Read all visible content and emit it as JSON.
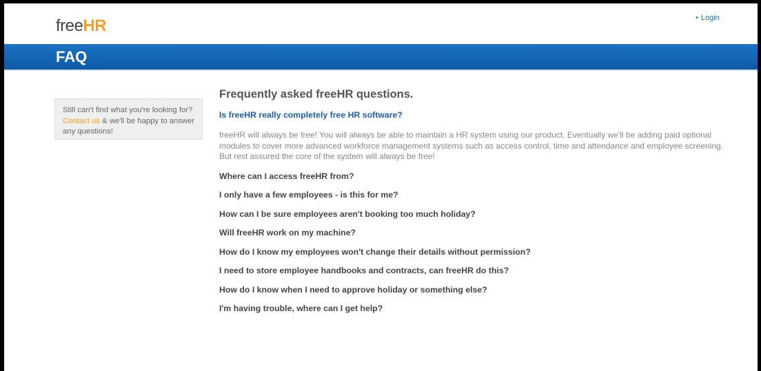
{
  "header": {
    "logo_free": "free",
    "logo_hr": "HR",
    "login_label": "Login"
  },
  "titlebar": {
    "title": "FAQ"
  },
  "sidebar": {
    "text_before": "Still can't find what you're looking for?",
    "contact_link": "Contact us",
    "text_after": "& we'll be happy to answer any questions!"
  },
  "main": {
    "heading": "Frequently asked freeHR questions.",
    "open_question": "Is freeHR really completely free HR software?",
    "open_answer": "freeHR will always be free! You will always be able to maintain a HR system using our product. Eventually we'll be adding paid optional modules to cover more advanced workforce management systems such as access control, time and attendance and employee screening. But rest assured the core of the system will always be free!",
    "questions": [
      "Where can I access freeHR from?",
      "I only have a few employees - is this for me?",
      "How can I be sure employees aren't booking too much holiday?",
      "Will freeHR work on my machine?",
      "How do I know my employees won't change their details without permission?",
      "I need to store employee handbooks and contracts, can freeHR do this?",
      "How do I know when I need to approve holiday or something else?",
      "I'm having trouble, where can I get help?"
    ]
  }
}
